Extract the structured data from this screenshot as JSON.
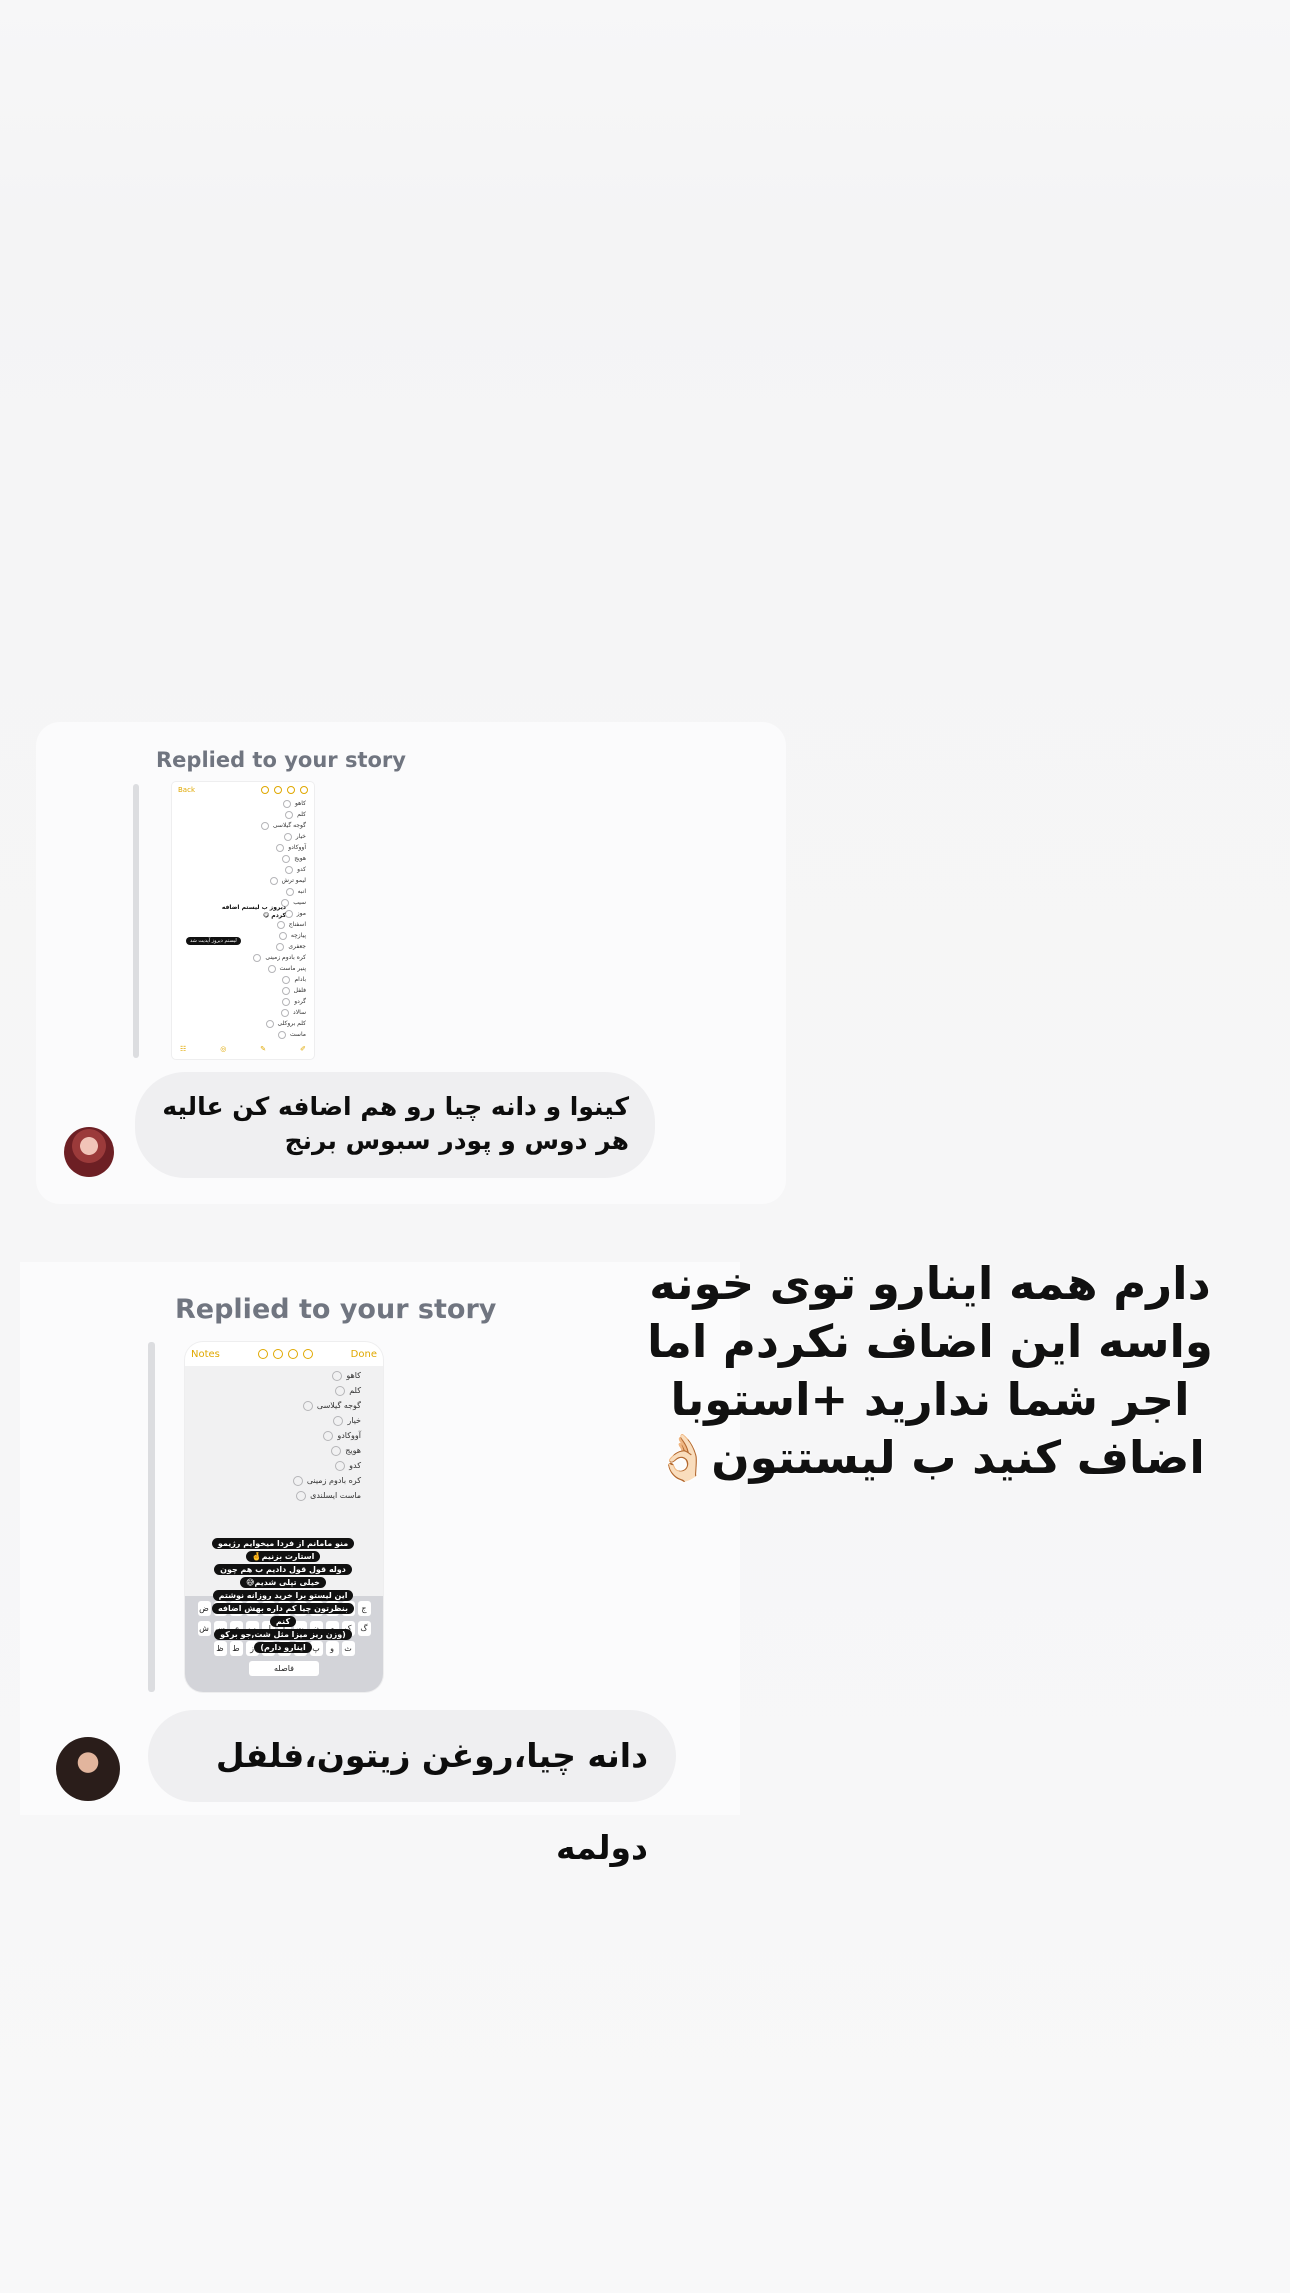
{
  "conversation": [
    {
      "replied_label": "Replied to your story",
      "story": {
        "back_label": "Back",
        "list_items": [
          "كاهو",
          "كلم",
          "گوجه گیلاسی",
          "خیار",
          "آووکادو",
          "هویج",
          "کدو",
          "لیمو ترش",
          "انبه",
          "سیب",
          "موز",
          "اسفناج",
          "پیازچه",
          "جعفری",
          "کره بادوم زمینی",
          "پنیر ماست",
          "بادام",
          "فلفل",
          "گردو",
          "سالاد",
          "کلم بروکلی",
          "ماست"
        ],
        "overlay_note": "دیروز ب لیستم اضافه کردم 😋",
        "overlay_pill": "لیستم دیروز آپدیت شد"
      },
      "message": "کینوا و دانه چیا رو هم اضافه کن عالیه هر دوس و پودر سبوس برنج"
    },
    {
      "replied_label": "Replied to your story",
      "story": {
        "back_label": "Notes",
        "done_label": "Done",
        "list_items": [
          "کاهو",
          "کلم",
          "گوجه گیلاسی",
          "خیار",
          "آووکادو",
          "هویج",
          "کدو",
          "کره بادوم زمینی",
          "ماست ایسلندی"
        ],
        "pill_lines": [
          "منو مامانم از فردا میخوایم رژیمو",
          "استارت بزنیم🤞",
          "دوله قول قول دادیم ب هم چون",
          "خیلی تپلی شدیم😅",
          "این لیستو برا خرید روزانه نوشتم",
          "بنظرتون چیا کم داره بهش اضافه",
          "کنم",
          "(وزن ریز میزا مثل شت,جو برکو",
          "اینارو دارم)"
        ],
        "keyboard_rows": [
          [
            "ض",
            "ص",
            "ث",
            "ق",
            "ف",
            "غ",
            "ع",
            "ه",
            "خ",
            "ح",
            "ج"
          ],
          [
            "ش",
            "س",
            "ی",
            "ب",
            "ل",
            "ا",
            "ت",
            "ن",
            "م",
            "ک",
            "گ"
          ],
          [
            "ظ",
            "ط",
            "ز",
            "ر",
            "ذ",
            "د",
            "پ",
            "و",
            "ث"
          ]
        ],
        "space_label": "فاصله"
      },
      "message": "دانه چیا،روغن زیتون،فلفل دولمه"
    }
  ],
  "caption": "دارم همه اینارو توی خونه واسه این اضاف نکردم اما اجر شما ندارید +استوبا اضاف کنید ب لیستتون👌🏻"
}
